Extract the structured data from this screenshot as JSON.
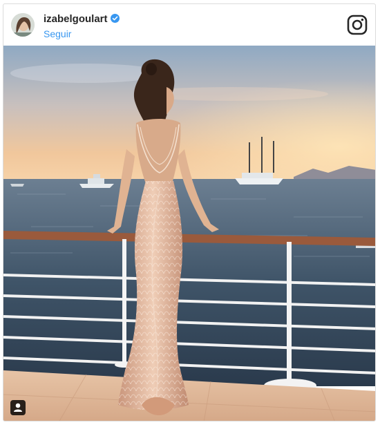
{
  "post": {
    "username": "izabelgoulart",
    "follow_label": "Seguir",
    "verified": true
  },
  "icons": {
    "header_logo": "instagram-icon",
    "verified": "verified-badge-icon",
    "tagged_users": "user-tag-icon"
  },
  "colors": {
    "link_blue": "#3897f0",
    "username": "#262626",
    "border": "#dbdbdb"
  }
}
